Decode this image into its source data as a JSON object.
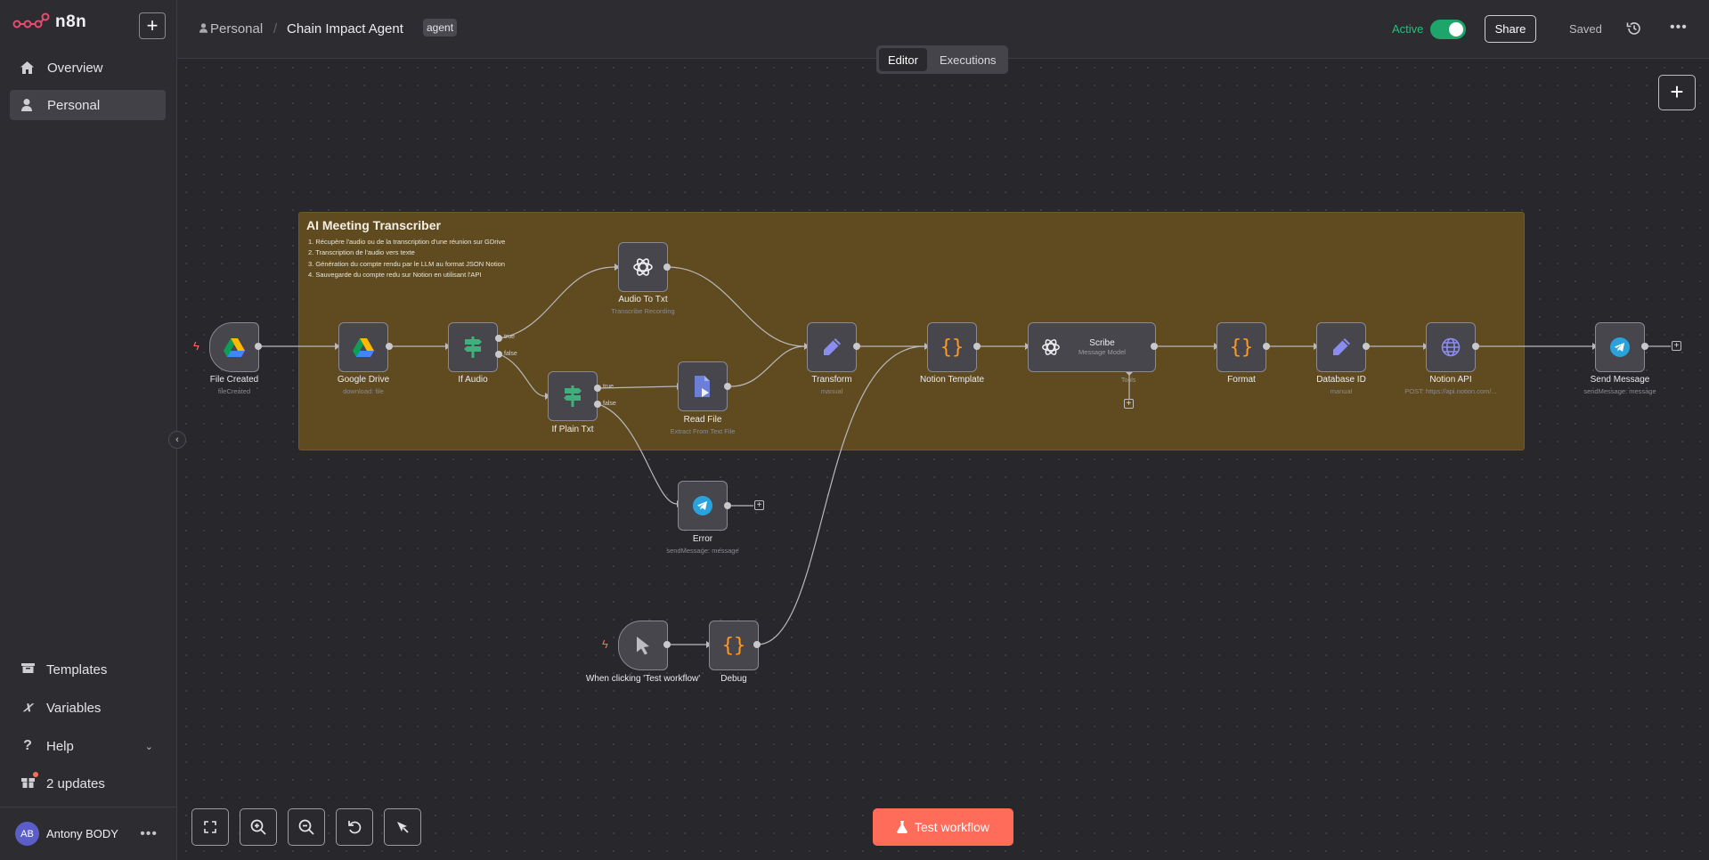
{
  "app": {
    "logo_text": "n8n"
  },
  "sidebar": {
    "items": [
      {
        "label": "Overview",
        "icon": "home-icon"
      },
      {
        "label": "Personal",
        "icon": "user-icon",
        "selected": true
      }
    ],
    "bottom": [
      {
        "label": "Templates",
        "icon": "box-icon"
      },
      {
        "label": "Variables",
        "icon": "variable-icon"
      },
      {
        "label": "Help",
        "icon": "question-icon"
      },
      {
        "label": "2 updates",
        "icon": "gift-icon"
      }
    ],
    "user": {
      "initials": "AB",
      "name": "Antony BODY",
      "more": "•••"
    }
  },
  "header": {
    "breadcrumb": "Personal",
    "separator": "/",
    "workflow_name": "Chain Impact Agent",
    "tag": "agent",
    "active_label": "Active",
    "active": true,
    "share_label": "Share",
    "saved_label": "Saved",
    "more": "•••",
    "tabs": [
      {
        "label": "Editor",
        "selected": true
      },
      {
        "label": "Executions",
        "selected": false
      }
    ]
  },
  "sticky": {
    "title": "AI Meeting Transcriber",
    "lines": [
      "1. Récupère l'audio ou de la transcription d'une réunion sur GDrive",
      "2. Transcription de l'audio vers texte",
      "3. Génération du compte rendu par le LLM au format JSON Notion",
      "4. Sauvegarde du compte redu sur Notion en utilisant l'API"
    ]
  },
  "nodes": {
    "file_created": {
      "label": "File Created",
      "sub": "fileCreated"
    },
    "google_drive": {
      "label": "Google Drive",
      "sub": "download: file"
    },
    "if_audio": {
      "label": "If Audio",
      "true": "true",
      "false": "false"
    },
    "audio_to_txt": {
      "label": "Audio To Txt",
      "sub": "Transcribe Recording"
    },
    "if_plain_txt": {
      "label": "If Plain Txt",
      "true": "true",
      "false": "false"
    },
    "read_file": {
      "label": "Read File",
      "sub": "Extract From Text File"
    },
    "transform": {
      "label": "Transform",
      "sub": "manual"
    },
    "notion_template": {
      "label": "Notion Template"
    },
    "scribe": {
      "label": "Scribe",
      "sub": "Message Model",
      "port": "Tools"
    },
    "format": {
      "label": "Format"
    },
    "database_id": {
      "label": "Database ID",
      "sub": "manual"
    },
    "notion_api": {
      "label": "Notion API",
      "sub": "POST: https://api.notion.com/..."
    },
    "send_message": {
      "label": "Send Message",
      "sub": "sendMessage: message"
    },
    "error": {
      "label": "Error",
      "sub": "sendMessage: message"
    },
    "manual_trigger": {
      "label": "When clicking 'Test workflow'"
    },
    "debug": {
      "label": "Debug"
    }
  },
  "canvas": {
    "test_button_label": "Test workflow"
  },
  "colors": {
    "accent": "#ff6d5a",
    "active": "#1ea66a",
    "sticky": "#5f4b1f"
  }
}
